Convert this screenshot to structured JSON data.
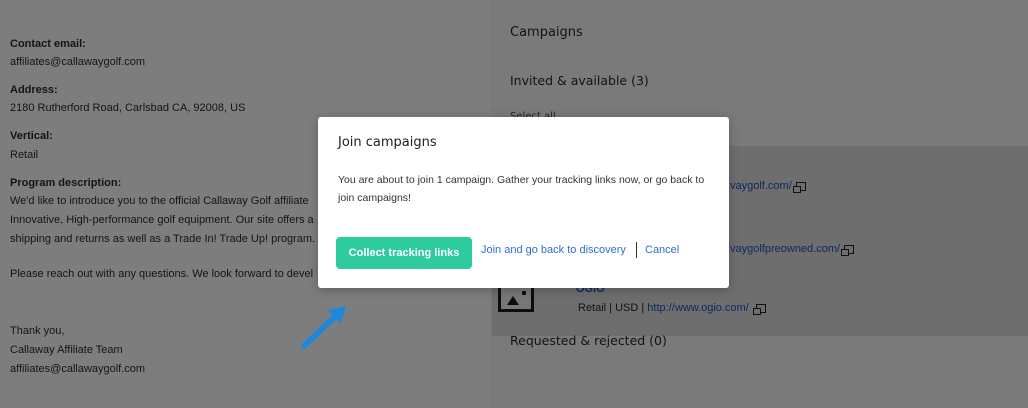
{
  "left": {
    "contact_email_label": "Contact email:",
    "contact_email": "affiliates@callawaygolf.com",
    "address_label": "Address:",
    "address": "2180 Rutherford Road, Carlsbad CA, 92008, US",
    "vertical_label": "Vertical:",
    "vertical": "Retail",
    "program_label": "Program description:",
    "program_lines": [
      "We'd like to introduce you to the official Callaway Golf affiliate",
      "Innovative, High-performance golf equipment. Our site offers a",
      "shipping and returns as well as a Trade In! Trade Up! program.",
      "Please reach out with any questions. We look forward to devel"
    ],
    "thanks": "Thank you,",
    "team": "Callaway Affiliate Team",
    "team_email": "affiliates@callawaygolf.com"
  },
  "right": {
    "campaigns_title": "Campaigns",
    "invited_title": "Invited & available (3)",
    "select_all": "Select all",
    "link1": "vaygolf.com/",
    "link2": "vaygolfpreowned.com/",
    "ogio_name": "OGIO",
    "ogio_meta": "Retail | USD |",
    "ogio_link": "http://www.ogio.com/",
    "requested_title": "Requested & rejected (0)"
  },
  "modal": {
    "title": "Join campaigns",
    "body": "You are about to join 1 campaign. Gather your tracking links now, or go back to join campaigns!",
    "primary_button": "Collect tracking links",
    "secondary_link": "Join and go back to discovery",
    "cancel_link": "Cancel"
  },
  "colors": {
    "primary": "#2dcb9e",
    "link": "#2f6fcc",
    "arrow": "#1e88d8"
  },
  "icons": [
    "copy-icon",
    "image-placeholder-icon",
    "arrow-icon"
  ]
}
